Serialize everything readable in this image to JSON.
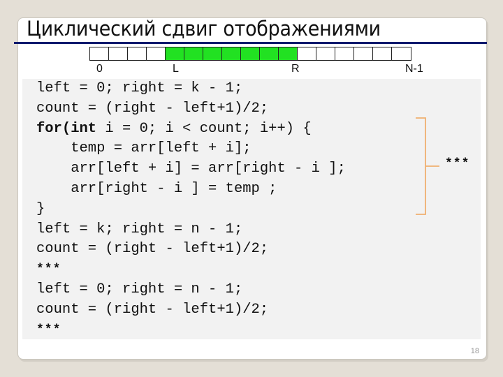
{
  "slide": {
    "title": "Циклический сдвиг отображениями",
    "page_number": "18",
    "accent_color": "#0a1a6e",
    "highlight_color": "#22e122",
    "bracket_color": "#f0b070"
  },
  "array": {
    "cells": [
      false,
      false,
      false,
      false,
      true,
      true,
      true,
      true,
      true,
      true,
      true,
      false,
      false,
      false,
      false,
      false,
      false
    ],
    "labels": {
      "zero": "0",
      "left": "L",
      "right": "R",
      "last": "N-1"
    }
  },
  "code": {
    "lines": [
      {
        "pre": "left = 0; right = k - 1;"
      },
      {
        "pre": "count = (right - left+1)/2;"
      },
      {
        "kw": "for(int",
        "post": " i = 0; i < count; i++) {"
      },
      {
        "pre": "    temp = arr[left + i];"
      },
      {
        "pre": "    arr[left + i] = arr[right - i ];"
      },
      {
        "pre": "    arr[right - i ] = temp ;"
      },
      {
        "pre": "}"
      },
      {
        "pre": "left = k; right = n - 1;"
      },
      {
        "pre": "count = (right - left+1)/2;"
      },
      {
        "stars": "***"
      },
      {
        "pre": "left = 0; right = n - 1;"
      },
      {
        "pre": "count = (right - left+1)/2;"
      },
      {
        "stars": "***"
      }
    ],
    "side_note": "***"
  }
}
